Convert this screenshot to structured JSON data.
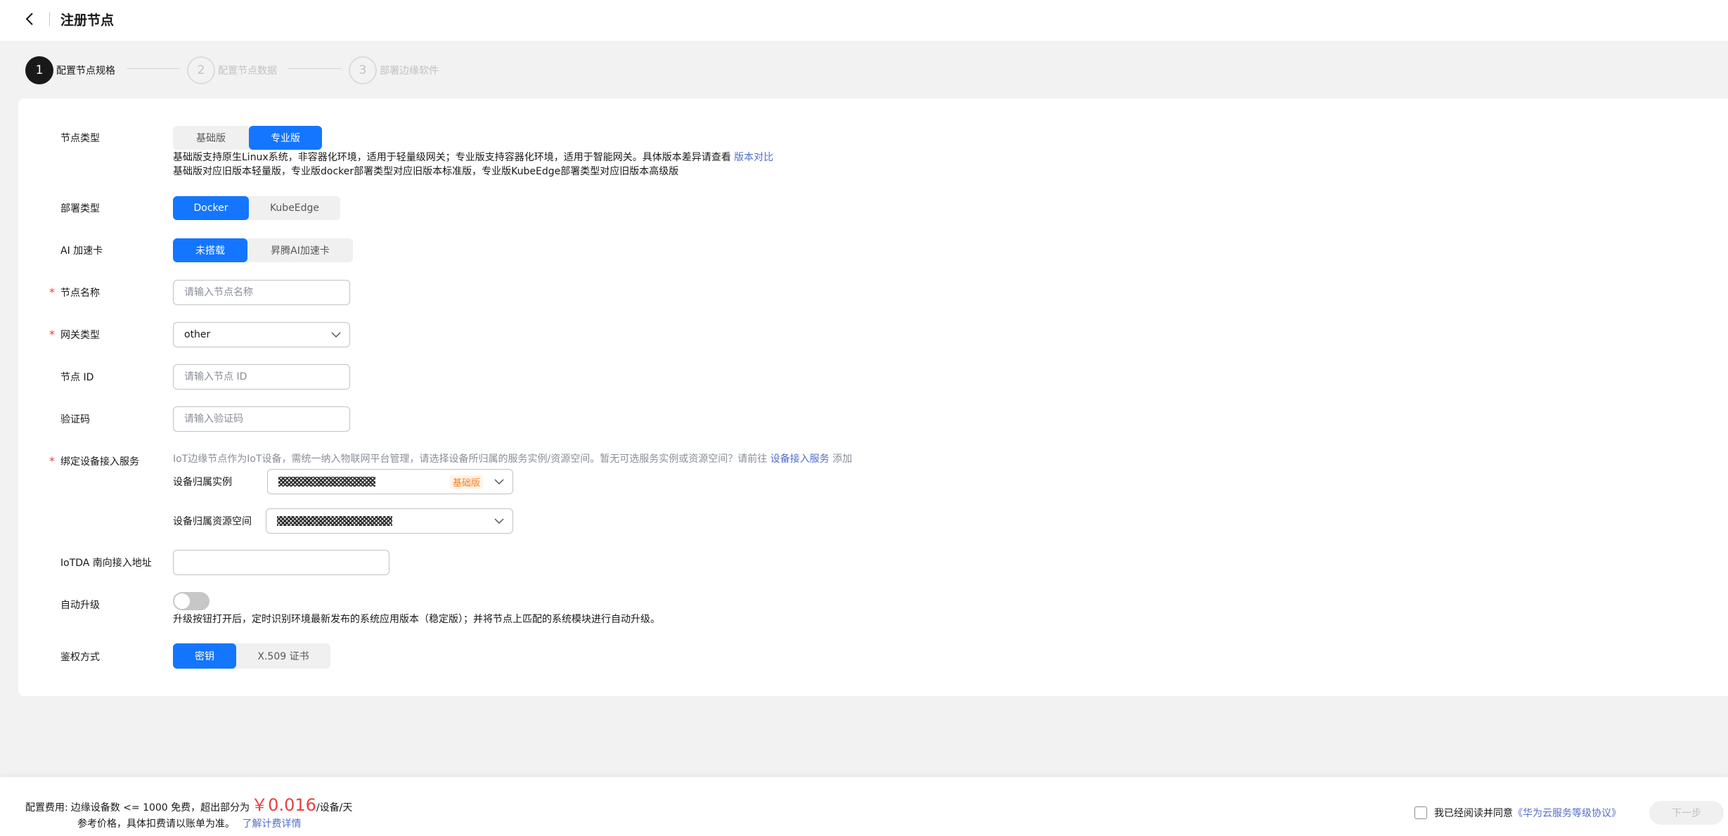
{
  "header": {
    "title": "注册节点"
  },
  "steps": [
    {
      "number": "1",
      "label": "配置节点规格",
      "state": "active"
    },
    {
      "number": "2",
      "label": "配置节点数据",
      "state": "inactive"
    },
    {
      "number": "3",
      "label": "部署边缘软件",
      "state": "inactive"
    }
  ],
  "form": {
    "node_type": {
      "label": "节点类型",
      "options": [
        "基础版",
        "专业版"
      ],
      "selected": "专业版",
      "hint_line1": "基础版支持原生Linux系统，非容器化环境，适用于轻量级网关；专业版支持容器化环境，适用于智能网关。具体版本差异请查看",
      "hint_link": "版本对比",
      "hint_line2": "基础版对应旧版本轻量版，专业版docker部署类型对应旧版本标准版，专业版KubeEdge部署类型对应旧版本高级版"
    },
    "deploy_type": {
      "label": "部署类型",
      "options": [
        "Docker",
        "KubeEdge"
      ],
      "selected": "Docker"
    },
    "ai_card": {
      "label": "AI 加速卡",
      "options": [
        "未搭载",
        "昇腾AI加速卡"
      ],
      "selected": "未搭载"
    },
    "node_name": {
      "label": "节点名称",
      "placeholder": "请输入节点名称",
      "required": true
    },
    "gateway_type": {
      "label": "网关类型",
      "value": "other",
      "required": true
    },
    "node_id": {
      "label": "节点 ID",
      "placeholder": "请输入节点 ID"
    },
    "verify_code": {
      "label": "验证码",
      "placeholder": "请输入验证码"
    },
    "bind_service": {
      "label": "绑定设备接入服务",
      "required": true,
      "hint_pre": "IoT边缘节点作为IoT设备，需统一纳入物联网平台管理，请选择设备所归属的服务实例/资源空间。暂无可选服务实例或资源空间？请前往",
      "hint_link": "设备接入服务",
      "hint_post": "添加",
      "instance_label": "设备归属实例",
      "instance_badge": "基础版",
      "space_label": "设备归属资源空间"
    },
    "iotda_address": {
      "label": "IoTDA 南向接入地址",
      "value": ""
    },
    "auto_upgrade": {
      "label": "自动升级",
      "enabled": false,
      "hint": "升级按钮打开后，定时识别环境最新发布的系统应用版本（稳定版）；并将节点上匹配的系统模块进行自动升级。"
    },
    "auth_mode": {
      "label": "鉴权方式",
      "options": [
        "密钥",
        "X.509 证书"
      ],
      "selected": "密钥"
    }
  },
  "footer": {
    "fee_prefix": "配置费用:",
    "fee_text": "边缘设备数 <= 1000 免费，超出部分为",
    "fee_price": "￥0.016",
    "fee_unit": "/设备/天",
    "fee_note": "参考价格，具体扣费请以账单为准。",
    "fee_link": "了解计费详情",
    "agree_text": "我已经阅读并同意",
    "agree_link": "《华为云服务等级协议》",
    "next_label": "下一步"
  },
  "colors": {
    "primary": "#1476ff",
    "link": "#526ecc",
    "danger": "#e84141",
    "badge": "#ff7a1a"
  }
}
